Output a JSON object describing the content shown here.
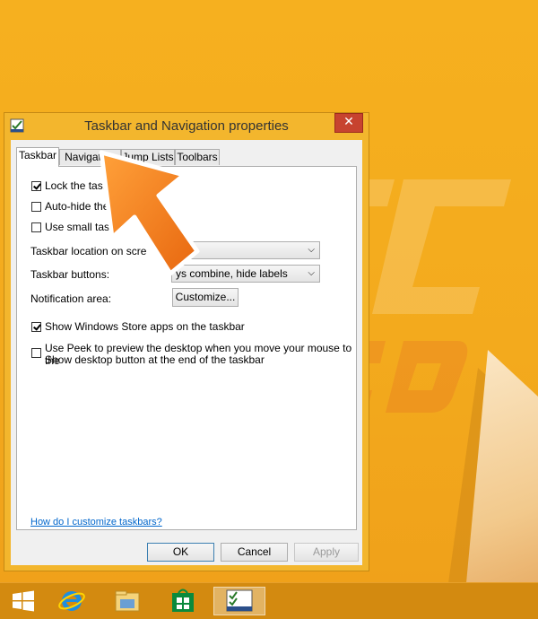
{
  "colors": {
    "desktop": "#f2a81c",
    "dialog_frame": "#f3b62d",
    "close_button": "#c7432f",
    "arrow_orange": "#f07d1a",
    "taskbar": "#d38a10",
    "link": "#0066cc"
  },
  "dialog": {
    "title": "Taskbar and Navigation properties",
    "close_glyph": "✕",
    "tabs": [
      "Taskbar",
      "Navigation",
      "Jump Lists",
      "Toolbars"
    ],
    "active_tab": "Taskbar",
    "options": {
      "lock_taskbar": {
        "label": "Lock the taskb",
        "checked": true
      },
      "auto_hide": {
        "label": "Auto-hide the",
        "checked": false
      },
      "small_buttons": {
        "label": "Use small task",
        "checked": false
      }
    },
    "location": {
      "label": "Taskbar location on scre",
      "value": "tom"
    },
    "buttons_setting": {
      "label": "Taskbar buttons:",
      "value": "ys combine, hide labels"
    },
    "notification": {
      "label": "Notification area:",
      "button": "Customize..."
    },
    "store_apps": {
      "label": "Show Windows Store apps on the taskbar",
      "checked": true
    },
    "peek": {
      "line1": "Use Peek to preview the desktop when you move your mouse to the",
      "line2": "Show desktop button at the end of the taskbar",
      "checked": false
    },
    "help_link": "How do I customize taskbars?",
    "footer": {
      "ok": "OK",
      "cancel": "Cancel",
      "apply": "Apply"
    }
  },
  "taskbar": {
    "items": [
      "start-icon",
      "internet-explorer-icon",
      "file-explorer-icon",
      "store-icon",
      "taskbar-properties-icon"
    ],
    "active": "taskbar-properties-icon"
  }
}
